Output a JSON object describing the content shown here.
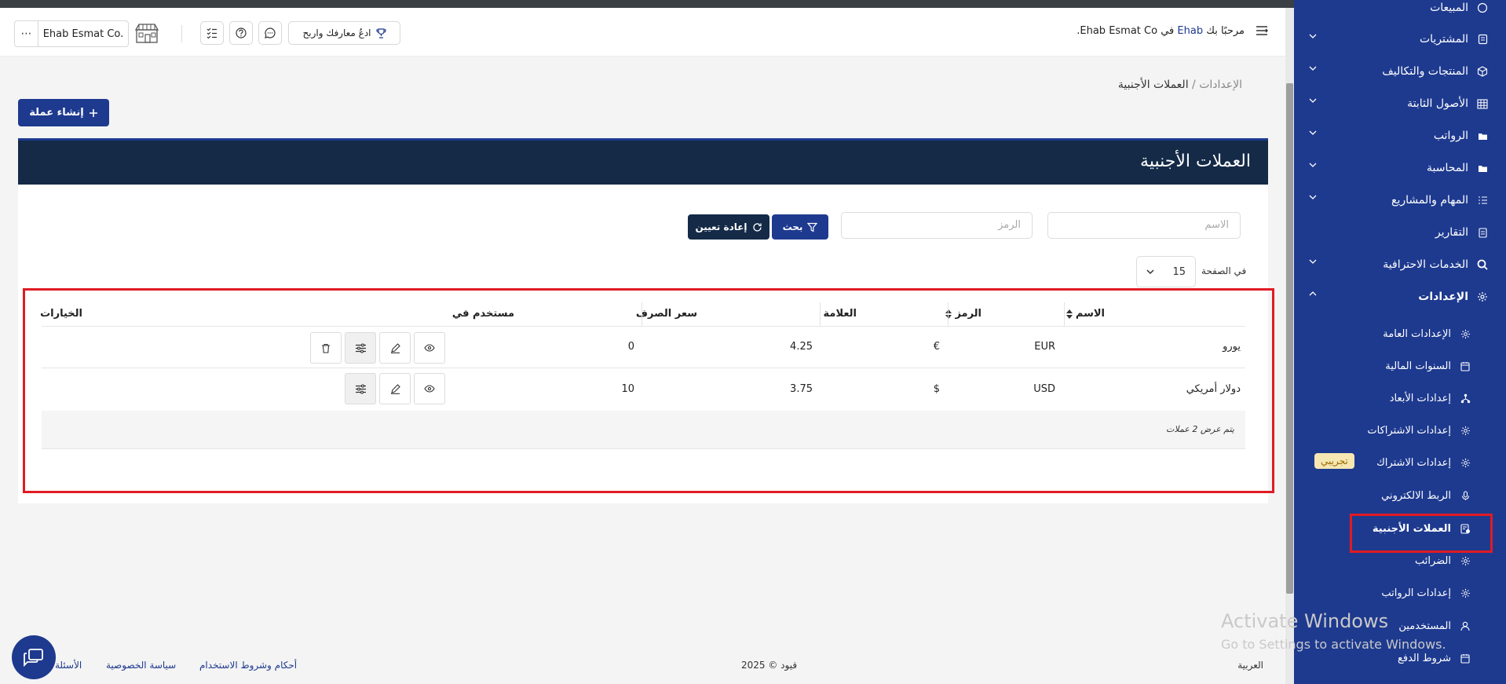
{
  "topbar": {
    "welcome_prefix": "مرحبًا بك",
    "user_name": "Ehab",
    "welcome_in": "في",
    "company": "Ehab Esmat Co.",
    "company_button": "Ehab Esmat Co.",
    "refer_label": "ادعُ معارفك واربح"
  },
  "breadcrumb": {
    "parent": "الإعدادات",
    "separator": "/",
    "current": "العملات الأجنبية"
  },
  "create_button": "إنشاء عملة",
  "panel": {
    "title": "العملات الأجنبية"
  },
  "filters": {
    "name_placeholder": "الاسم",
    "code_placeholder": "الرمز",
    "search_label": "بحث",
    "reset_label": "إعادة تعيين",
    "per_page_label": "في الصفحة",
    "per_page_value": "15"
  },
  "table": {
    "columns": [
      "الاسم",
      "الرمز",
      "العلامة",
      "سعر الصرف",
      "مستخدم في",
      "الخيارات"
    ],
    "rows": [
      {
        "name": "يورو",
        "code": "EUR",
        "symbol": "€",
        "rate": "4.25",
        "used_in": "0"
      },
      {
        "name": "دولار أمريكي",
        "code": "USD",
        "symbol": "$",
        "rate": "3.75",
        "used_in": "10"
      }
    ],
    "summary": "يتم عرض 2 عملات"
  },
  "sidebar": {
    "items": [
      {
        "label": "المبيعات",
        "icon": "sales-icon"
      },
      {
        "label": "المشتريات",
        "icon": "purchases-icon"
      },
      {
        "label": "المنتجات والتكاليف",
        "icon": "box-icon"
      },
      {
        "label": "الأصول الثابتة",
        "icon": "grid-icon"
      },
      {
        "label": "الرواتب",
        "icon": "folder-icon"
      },
      {
        "label": "المحاسبة",
        "icon": "folder-icon"
      },
      {
        "label": "المهام والمشاريع",
        "icon": "list-icon"
      },
      {
        "label": "التقارير",
        "icon": "report-icon"
      },
      {
        "label": "الخدمات الاحترافية",
        "icon": "search-icon"
      },
      {
        "label": "الإعدادات",
        "icon": "gear-icon"
      }
    ],
    "sub_items": [
      {
        "label": "الإعدادات العامة",
        "icon": "gear-icon"
      },
      {
        "label": "السنوات المالية",
        "icon": "calendar-icon"
      },
      {
        "label": "إعدادات الأبعاد",
        "icon": "dimensions-icon"
      },
      {
        "label": "إعدادات الاشتراكات",
        "icon": "gear-icon"
      },
      {
        "label": "إعدادات الاشتراك",
        "icon": "gear-icon",
        "badge": "تجريبي"
      },
      {
        "label": "الربط الالكتروني",
        "icon": "microphone-icon"
      },
      {
        "label": "العملات الأجنبية",
        "icon": "currency-icon"
      },
      {
        "label": "الضرائب",
        "icon": "gear-icon"
      },
      {
        "label": "إعدادات الرواتب",
        "icon": "gear-icon"
      },
      {
        "label": "المستخدمين",
        "icon": "user-icon"
      },
      {
        "label": "شروط الدفع",
        "icon": "calendar-icon"
      }
    ]
  },
  "footer": {
    "language": "العربية",
    "copyright": "قيود © 2025",
    "terms": "أحكام وشروط الاستخدام",
    "privacy": "سياسة الخصوصية",
    "faq": "الأسئلة"
  },
  "watermark": {
    "line1": "Activate Windows",
    "line2": "Go to Settings to activate Windows."
  },
  "colors": {
    "primary": "#1e3a8f",
    "dark": "#142a47",
    "highlight": "#e01b24"
  }
}
